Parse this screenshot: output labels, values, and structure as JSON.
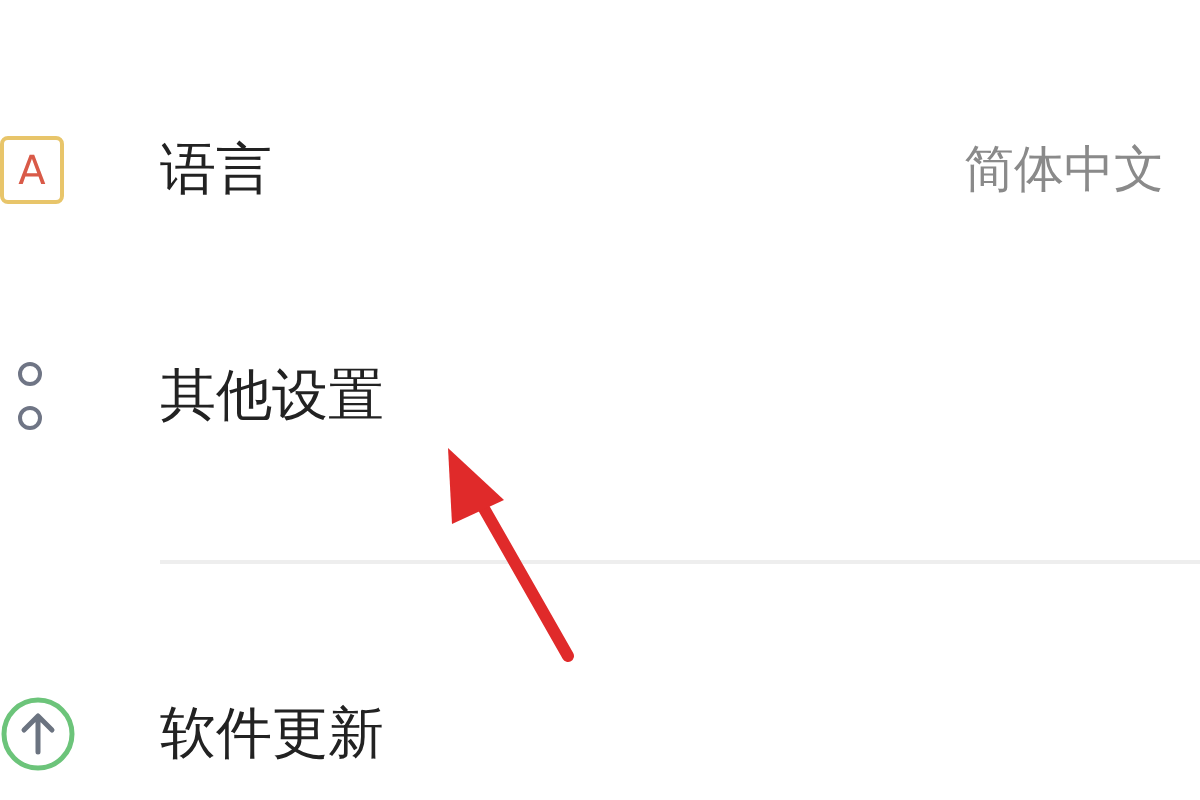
{
  "settings": [
    {
      "kind": "letter",
      "icon_text": "A",
      "label": "语言",
      "value": "简体中文"
    },
    {
      "kind": "dots",
      "label": "其他设置"
    },
    {
      "kind": "divider"
    },
    {
      "kind": "update",
      "label": "软件更新"
    }
  ]
}
